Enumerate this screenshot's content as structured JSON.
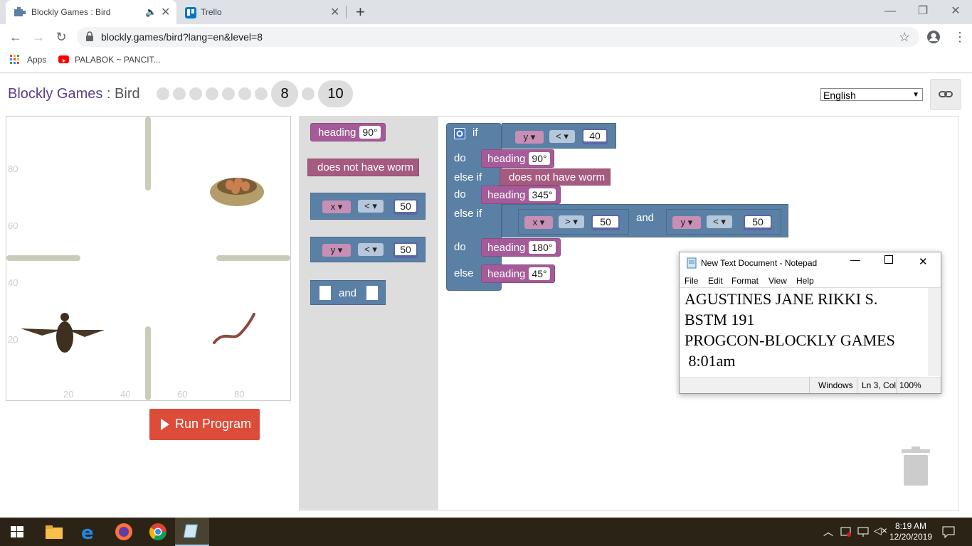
{
  "browser": {
    "tabs": [
      {
        "title": "Blockly Games : Bird"
      },
      {
        "title": "Trello"
      }
    ],
    "url": "blockly.games/bird?lang=en&level=8",
    "bookmarks": [
      "Apps",
      "PALABOK ~ PANCIT..."
    ],
    "accent": "#1a73e8"
  },
  "header": {
    "brand": "Blockly Games",
    "separator": " : ",
    "game": "Bird",
    "current_level": "8",
    "last_level": "10",
    "language": "English"
  },
  "viz": {
    "y_ticks": [
      "80",
      "60",
      "40",
      "20"
    ],
    "x_ticks": [
      "20",
      "40",
      "60",
      "80"
    ]
  },
  "run_button": "Run Program",
  "flyout": {
    "heading_label": "heading",
    "heading_value": "90°",
    "worm_label": "does not have worm",
    "x_var": "x",
    "y_var": "y",
    "lt": "<",
    "x_cmp_value": "50",
    "y_cmp_value": "50",
    "and_label": "and"
  },
  "program": {
    "if_label": "if",
    "do_label": "do",
    "else_if_label": "else if",
    "else_label": "else",
    "heading_label": "heading",
    "cond1": {
      "var": "y",
      "op": "<",
      "value": "40"
    },
    "heading1": "90°",
    "cond2": "does not have worm",
    "heading2": "345°",
    "cond3a": {
      "var": "x",
      "op": ">",
      "value": "50"
    },
    "and_label": "and",
    "cond3b": {
      "var": "y",
      "op": "<",
      "value": "50"
    },
    "heading3": "180°",
    "heading4": "45°"
  },
  "notepad": {
    "title": "New Text Document - Notepad",
    "menu": [
      "File",
      "Edit",
      "Format",
      "View",
      "Help"
    ],
    "text": "AGUSTINES JANE RIKKI S.\nBSTM 191\nPROGCON-BLOCKLY GAMES\n 8:01am",
    "status_encoding": "Windows",
    "status_position": "Ln 3, Col",
    "status_zoom": "100%"
  },
  "taskbar": {
    "time": "8:19 AM",
    "date": "12/20/2019"
  }
}
